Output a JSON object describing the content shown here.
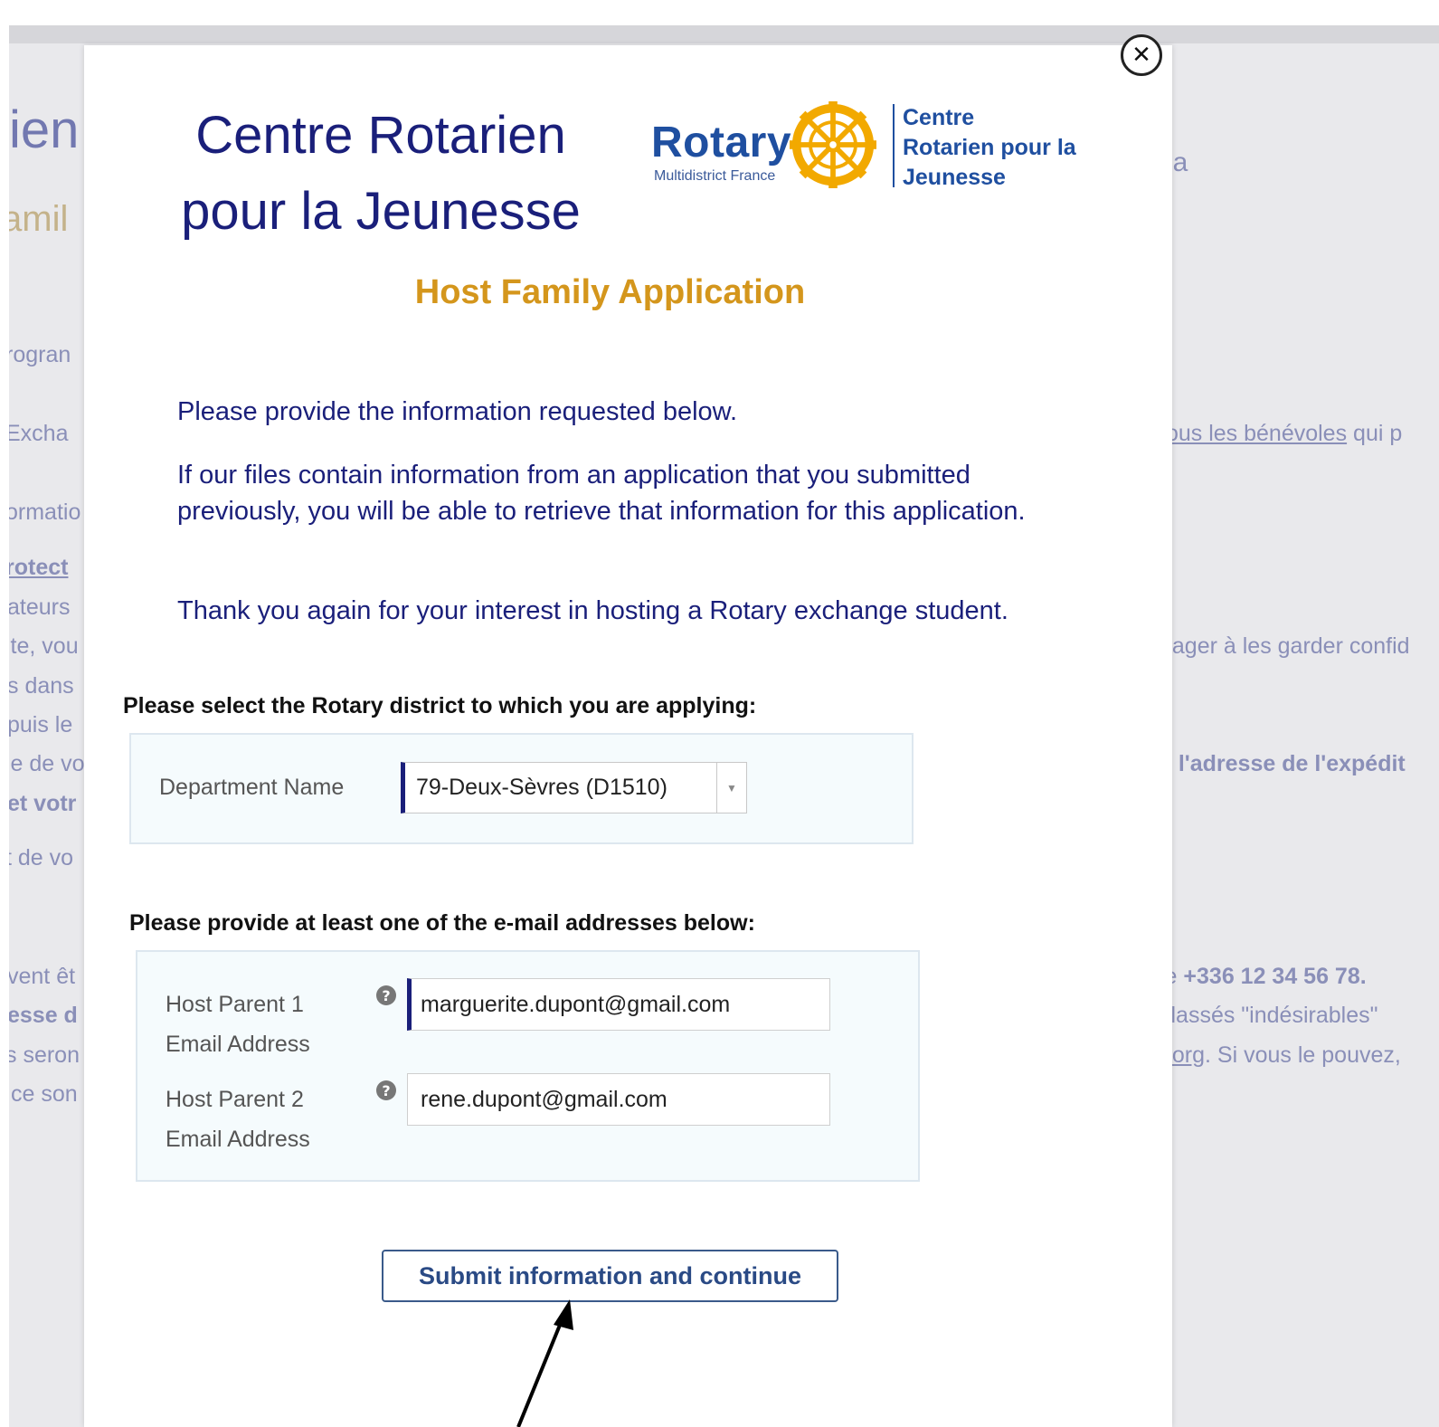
{
  "background": {
    "title_fragment": "ien",
    "subtitle_fragment": "amil",
    "right_fragment": "la",
    "left_lines": [
      "rogran",
      "Excha",
      "ormatio",
      "rotect",
      "ateurs",
      "ite, vou",
      "s dans",
      "puis le",
      "ie de vo",
      "et votr",
      "t de vo",
      "vent êt",
      "esse d",
      "s seron",
      "ce son"
    ],
    "right_lines": {
      "volunteers_link": "tous les bénévoles",
      "volunteers_rest": " qui p",
      "confidential": "gager à les garder confid",
      "sender_address": "à l'adresse de l'expédit",
      "phone_prefix": "le ",
      "phone": "+336 12 34 56 78.",
      "undesirable": "classés \"indésirables\"",
      "org_link": "t.org",
      "org_rest": ". Si vous le pouvez,"
    }
  },
  "modal": {
    "close_symbol": "✕",
    "brand_title_line1": "Centre Rotarien",
    "brand_title_line2": "pour la Jeunesse",
    "logo": {
      "word": "Rotary",
      "sub": "Multidistrict France",
      "right_line1": "Centre",
      "right_line2": "Rotarien pour la",
      "right_line3": "Jeunesse",
      "wheel_color": "#f2a900"
    },
    "heading": "Host Family Application",
    "intro_p1": "Please provide the information requested below.",
    "intro_p2": "If our files contain information from an application that you submitted previously, you will be able to retrieve that information for this application.",
    "intro_p3": "Thank you again for your interest in hosting a Rotary exchange student.",
    "district_label": "Please select the Rotary district to which you are applying:",
    "department_label": "Department Name",
    "department_value": "79-Deux-Sèvres (D1510)",
    "email_label": "Please provide at least one of the e-mail addresses below:",
    "parent1_label_line1": "Host Parent 1",
    "parent1_label_line2": "Email Address",
    "parent1_email": "marguerite.dupont@gmail.com",
    "parent2_label_line1": "Host Parent 2",
    "parent2_label_line2": "Email Address",
    "parent2_email": "rene.dupont@gmail.com",
    "help_symbol": "?",
    "submit_label": "Submit information and continue"
  },
  "colors": {
    "brand_navy": "#1a1f7a",
    "heading_gold": "#d4961c",
    "rotary_blue": "#1f4fa0"
  }
}
